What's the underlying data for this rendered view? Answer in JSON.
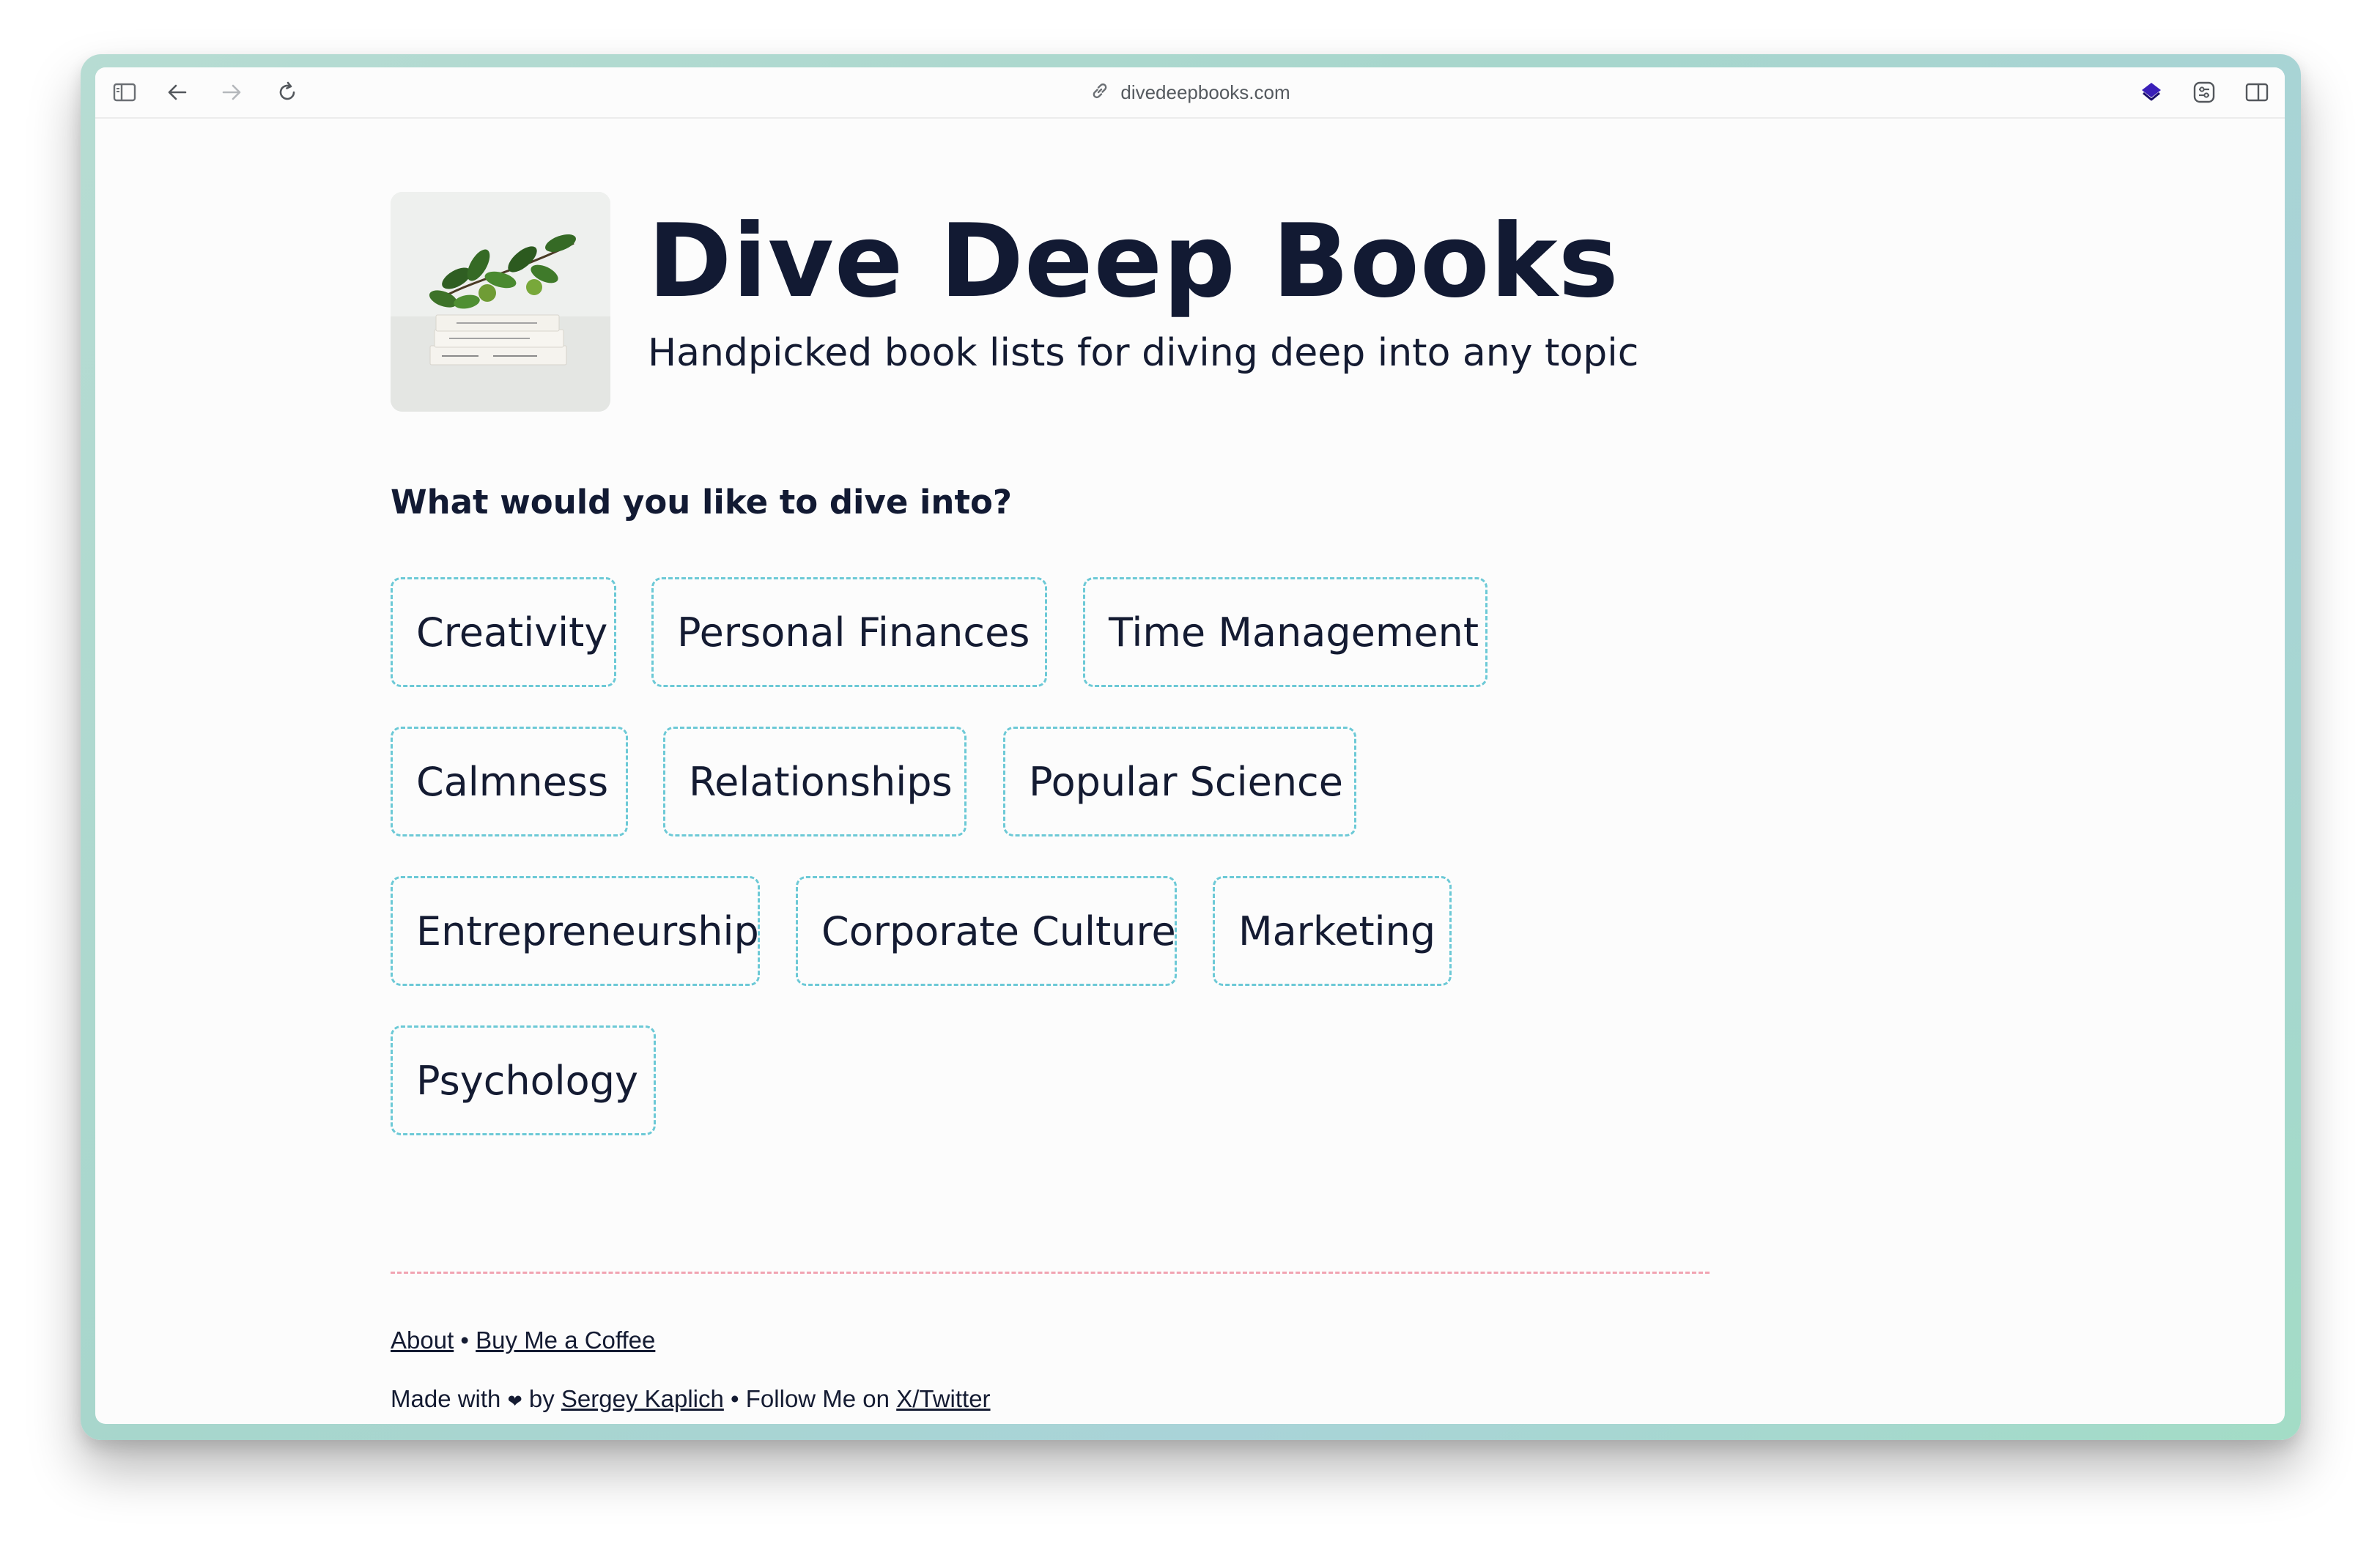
{
  "browser": {
    "url": "divedeepbooks.com",
    "icons": {
      "sidebar": "sidebar-icon",
      "back": "back-arrow-icon",
      "forward": "forward-arrow-icon",
      "reload": "reload-icon",
      "link": "link-icon",
      "extension": "extension-icon",
      "settings": "settings-icon",
      "split_view": "split-view-icon"
    }
  },
  "header": {
    "title": "Dive Deep Books",
    "tagline": "Handpicked book lists for diving deep into any topic",
    "image": "books-with-lemon-branch"
  },
  "main": {
    "prompt": "What would you like to dive into?",
    "topics": [
      "Creativity",
      "Personal Finances",
      "Time Management",
      "Calmness",
      "Relationships",
      "Popular Science",
      "Entrepreneurship",
      "Corporate Culture",
      "Marketing",
      "Psychology"
    ]
  },
  "footer": {
    "about": "About",
    "separator": "•",
    "buy_coffee": "Buy Me a Coffee",
    "made_with": "Made with",
    "heart": "❤",
    "by": "by",
    "author": "Sergey Kaplich",
    "follow": "Follow Me on",
    "twitter": "X/Twitter"
  },
  "colors": {
    "title": "#121a33",
    "topic_border": "#6cc9d6",
    "divider": "#f1a3b2",
    "extension_accent": "#3a1fb8",
    "frame_border": "#a7d6cc"
  }
}
